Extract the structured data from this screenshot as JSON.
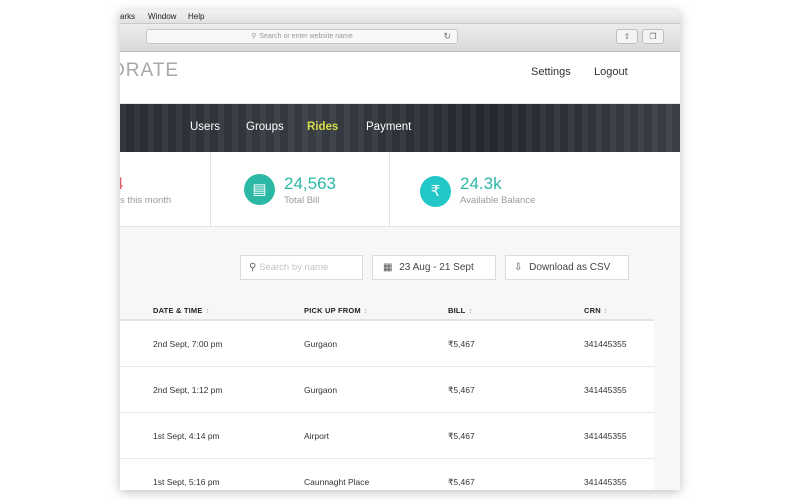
{
  "menubar": {
    "items": [
      "arks",
      "Window",
      "Help"
    ]
  },
  "browser": {
    "url_placeholder": "Search or enter website name"
  },
  "header": {
    "logo": "ORATE",
    "links": {
      "settings": "Settings",
      "logout": "Logout"
    }
  },
  "nav": {
    "items": [
      {
        "label": "Users",
        "active": false
      },
      {
        "label": "Groups",
        "active": false
      },
      {
        "label": "Rides",
        "active": true
      },
      {
        "label": "Payment",
        "active": false
      }
    ],
    "active_color": "#d7dc4a"
  },
  "stats": {
    "partial": {
      "value": "4",
      "label": "s this month",
      "color": "#e05a6b"
    },
    "total_bill": {
      "value": "24,563",
      "label": "Total Bill",
      "icon": "bill-icon",
      "color": "#2bb8a5"
    },
    "balance": {
      "value": "24.3k",
      "label": "Available Balance",
      "icon": "rupee-icon",
      "color": "#2bb8a5"
    }
  },
  "filters": {
    "search_placeholder": "Search by name",
    "date_range": "23 Aug - 21 Sept",
    "download": "Download as CSV"
  },
  "table": {
    "columns": [
      "DATE & TIME",
      "PICK UP FROM",
      "BILL",
      "CRN"
    ],
    "rows": [
      {
        "datetime": "2nd Sept, 7:00 pm",
        "pickup": "Gurgaon",
        "bill": "₹5,467",
        "crn": "341445355"
      },
      {
        "datetime": "2nd Sept, 1:12 pm",
        "pickup": "Gurgaon",
        "bill": "₹5,467",
        "crn": "341445355"
      },
      {
        "datetime": "1st Sept, 4:14 pm",
        "pickup": "Airport",
        "bill": "₹5,467",
        "crn": "341445355"
      },
      {
        "datetime": "1st Sept, 5:16 pm",
        "pickup": "Caunnaght Place",
        "bill": "₹5,467",
        "crn": "341445355"
      }
    ]
  }
}
